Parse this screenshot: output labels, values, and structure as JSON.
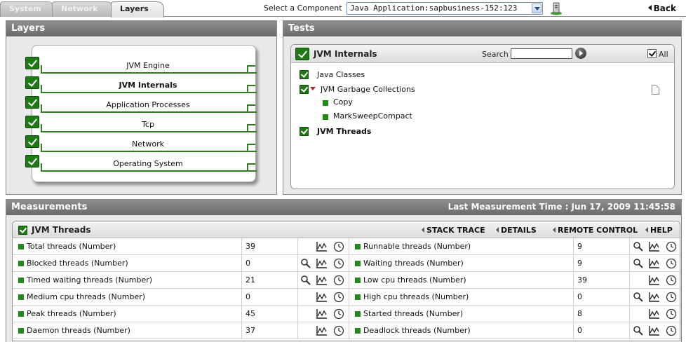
{
  "tabs": [
    {
      "label": "System",
      "active": false
    },
    {
      "label": "Network",
      "active": false
    },
    {
      "label": "Layers",
      "active": true
    }
  ],
  "component": {
    "label": "Select a Component",
    "selected": "Java Application:sapbusiness-152:123"
  },
  "back_label": "Back",
  "layers_panel": {
    "title": "Layers",
    "items": [
      {
        "label": "JVM Engine",
        "selected": false
      },
      {
        "label": "JVM Internals",
        "selected": true
      },
      {
        "label": "Application Processes",
        "selected": false
      },
      {
        "label": "Tcp",
        "selected": false
      },
      {
        "label": "Network",
        "selected": false
      },
      {
        "label": "Operating System",
        "selected": false
      }
    ]
  },
  "tests_panel": {
    "title": "Tests",
    "header_title": "JVM Internals",
    "search_label": "Search",
    "search_value": "",
    "all_label": "All",
    "items": [
      {
        "label": "Java Classes",
        "type": "checkbox",
        "bold": false
      },
      {
        "label": "JVM Garbage Collections",
        "type": "checkbox-expand",
        "bold": false
      },
      {
        "label": "Copy",
        "type": "child",
        "bold": false
      },
      {
        "label": "MarkSweepCompact",
        "type": "child",
        "bold": false
      },
      {
        "label": "JVM Threads",
        "type": "checkbox",
        "bold": true
      }
    ]
  },
  "measurements_panel": {
    "title": "Measurements",
    "last_time": "Last Measurement Time : Jun 17, 2009 11:45:58",
    "header_title": "JVM Threads",
    "links": [
      "STACK TRACE",
      "DETAILS",
      "REMOTE CONTROL",
      "HELP"
    ],
    "rows": [
      {
        "left_name": "Total threads (Number)",
        "left_value": "39",
        "left_zoom": false,
        "right_name": "Runnable threads (Number)",
        "right_value": "9",
        "right_zoom": true
      },
      {
        "left_name": "Blocked threads (Number)",
        "left_value": "0",
        "left_zoom": true,
        "right_name": "Waiting threads (Number)",
        "right_value": "9",
        "right_zoom": true
      },
      {
        "left_name": "Timed waiting threads (Number)",
        "left_value": "21",
        "left_zoom": true,
        "right_name": "Low cpu threads (Number)",
        "right_value": "39",
        "right_zoom": false
      },
      {
        "left_name": "Medium cpu threads (Number)",
        "left_value": "0",
        "left_zoom": false,
        "right_name": "High cpu threads (Number)",
        "right_value": "0",
        "right_zoom": true
      },
      {
        "left_name": "Peak threads (Number)",
        "left_value": "45",
        "left_zoom": false,
        "right_name": "Started threads (Number)",
        "right_value": "8",
        "right_zoom": false
      },
      {
        "left_name": "Daemon threads (Number)",
        "left_value": "37",
        "left_zoom": false,
        "right_name": "Deadlock threads (Number)",
        "right_value": "0",
        "right_zoom": true
      }
    ]
  },
  "colors": {
    "accent_green": "#1f7a15",
    "header_grey": "#7a7a7a"
  }
}
